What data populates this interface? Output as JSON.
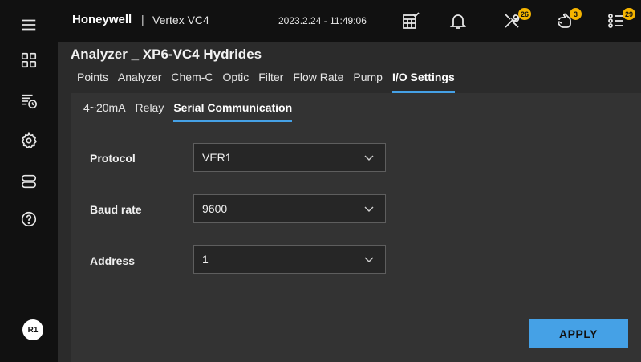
{
  "header": {
    "brand": "Honeywell",
    "separator": "|",
    "product": "Vertex VC4",
    "datetime": "2023.2.24 - 11:49:06",
    "badges": {
      "tools": "26",
      "hand": "3",
      "list": "29"
    }
  },
  "sidebar": {
    "user_initials": "R1",
    "icons": [
      "menu-icon",
      "grid-icon",
      "list-clock-icon",
      "gear-icon",
      "device-icon",
      "help-icon"
    ]
  },
  "page": {
    "title": "Analyzer _ XP6-VC4 Hydrides",
    "tabs": [
      {
        "label": "Points"
      },
      {
        "label": "Analyzer"
      },
      {
        "label": "Chem-C"
      },
      {
        "label": "Optic"
      },
      {
        "label": "Filter"
      },
      {
        "label": "Flow Rate"
      },
      {
        "label": "Pump"
      },
      {
        "label": "I/O Settings",
        "active": true
      }
    ],
    "subtabs": [
      {
        "label": "4~20mA"
      },
      {
        "label": "Relay"
      },
      {
        "label": "Serial Communication",
        "active": true
      }
    ]
  },
  "form": {
    "protocol": {
      "label": "Protocol",
      "value": "VER1"
    },
    "baud_rate": {
      "label": "Baud rate",
      "value": "9600"
    },
    "address": {
      "label": "Address",
      "value": "1"
    }
  },
  "actions": {
    "apply_label": "APPLY"
  },
  "colors": {
    "accent": "#45a1e6",
    "badge": "#f5b400"
  }
}
